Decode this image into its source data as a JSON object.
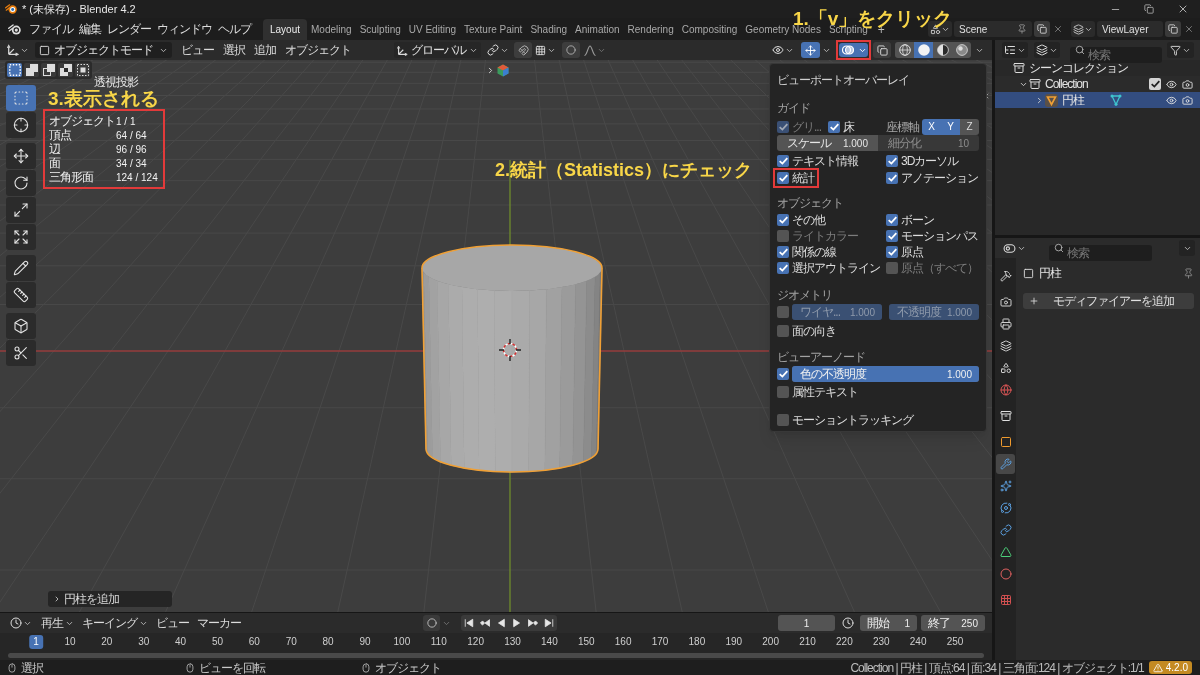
{
  "title_bar": {
    "title": "* (未保存) - Blender 4.2"
  },
  "top_bar": {
    "menus": [
      "ファイル",
      "編集",
      "レンダー",
      "ウィンドウ",
      "ヘルプ"
    ],
    "workspaces": [
      {
        "label": "Layout",
        "selected": true
      },
      {
        "label": "Modeling",
        "selected": false
      },
      {
        "label": "Sculpting",
        "selected": false
      },
      {
        "label": "UV Editing",
        "selected": false
      },
      {
        "label": "Texture Paint",
        "selected": false
      },
      {
        "label": "Shading",
        "selected": false
      },
      {
        "label": "Animation",
        "selected": false
      },
      {
        "label": "Rendering",
        "selected": false
      },
      {
        "label": "Compositing",
        "selected": false
      },
      {
        "label": "Geometry Nodes",
        "selected": false
      },
      {
        "label": "Scripting",
        "selected": false
      }
    ],
    "add_workspace": "+",
    "scene": "Scene",
    "view_layer": "ViewLayer"
  },
  "viewport_header": {
    "mode": "オブジェクトモード",
    "menus": [
      "ビュー",
      "選択",
      "追加",
      "オブジェクト"
    ],
    "orientation": "グローバル",
    "gizmos_on": true,
    "overlays_on": true,
    "overlays_highlighted": true,
    "shading": [
      {
        "kind": "wireframe",
        "selected": false
      },
      {
        "kind": "solid",
        "selected": true
      },
      {
        "kind": "material",
        "selected": false
      },
      {
        "kind": "rendered",
        "selected": false
      }
    ]
  },
  "viewport": {
    "select_modes": [
      {
        "kind": "new",
        "selected": true
      },
      {
        "kind": "extend",
        "selected": false
      },
      {
        "kind": "subtract",
        "selected": false
      },
      {
        "kind": "invert",
        "selected": false
      },
      {
        "kind": "intersect",
        "selected": false
      }
    ],
    "tool_settings_expanded": false,
    "tools": [
      {
        "kind": "select_box",
        "selected": true
      },
      {
        "kind": "cursor",
        "selected": false
      },
      {
        "kind": "move",
        "selected": false
      },
      {
        "kind": "rotate",
        "selected": false
      },
      {
        "kind": "scale",
        "selected": false
      },
      {
        "kind": "transform",
        "selected": false
      },
      {
        "kind": "annotate",
        "selected": false
      },
      {
        "kind": "measure",
        "selected": false
      },
      {
        "kind": "add_cube",
        "selected": false
      },
      {
        "kind": "cut",
        "selected": false
      }
    ],
    "view_name": "透視投影",
    "statistics": {
      "highlighted": true,
      "rows": [
        {
          "label": "オブジェクト",
          "value": "1 / 1"
        },
        {
          "label": "頂点",
          "value": "64 / 64"
        },
        {
          "label": "辺",
          "value": "96 / 96"
        },
        {
          "label": "面",
          "value": "34 / 34"
        },
        {
          "label": "三角形面",
          "value": "124 / 124"
        }
      ]
    },
    "last_operator": "円柱を追加"
  },
  "overlay_popup": {
    "title": "ビューポートオーバーレイ",
    "guides": {
      "title": "ガイド",
      "grid": {
        "label": "グリ...",
        "checked": true,
        "disabled": true
      },
      "floor": {
        "label": "床",
        "checked": true
      },
      "axes_label": "座標軸",
      "axes": [
        {
          "label": "X",
          "selected": true
        },
        {
          "label": "Y",
          "selected": true
        },
        {
          "label": "Z",
          "selected": false
        }
      ],
      "scale": {
        "label": "スケール",
        "value": "1.000"
      },
      "subdivisions": {
        "label": "細分化",
        "value": "10",
        "disabled": true
      },
      "options": [
        {
          "label": "テキスト情報",
          "checked": true,
          "highlighted": false
        },
        {
          "label": "3Dカーソル",
          "checked": true,
          "highlighted": false
        },
        {
          "label": "統計",
          "checked": true,
          "highlighted": true
        },
        {
          "label": "アノテーション",
          "checked": true,
          "highlighted": false
        }
      ]
    },
    "objects": {
      "title": "オブジェクト",
      "options": [
        {
          "label": "その他",
          "checked": true,
          "disabled": false
        },
        {
          "label": "ボーン",
          "checked": true,
          "disabled": false
        },
        {
          "label": "ライトカラー",
          "checked": false,
          "disabled": true
        },
        {
          "label": "モーションパス",
          "checked": true,
          "disabled": false
        },
        {
          "label": "関係の線",
          "checked": true,
          "disabled": false
        },
        {
          "label": "原点",
          "checked": true,
          "disabled": false
        },
        {
          "label": "選択アウトライン",
          "checked": true,
          "disabled": false
        },
        {
          "label": "原点（すべて）",
          "checked": false,
          "disabled": true
        }
      ]
    },
    "geometry": {
      "title": "ジオメトリ",
      "wireframe": {
        "checked": false,
        "label": "ワイヤ...",
        "value": "1.000",
        "level": 1,
        "disabled": true
      },
      "opacity": {
        "label": "不透明度",
        "value": "1.000",
        "level": 1,
        "disabled": true
      },
      "options": [
        {
          "label": "面の向き",
          "checked": false
        }
      ]
    },
    "viewer_node": {
      "title": "ビューアーノード",
      "color_opacity": {
        "checked": true,
        "label": "色の不透明度",
        "value": "1.000",
        "level": 1
      },
      "options": [
        {
          "label": "属性テキスト",
          "checked": false
        }
      ]
    },
    "motion_tracking": {
      "label": "モーショントラッキング",
      "checked": false
    }
  },
  "outliner": {
    "search_placeholder": "検索",
    "tree": [
      {
        "label": "シーンコレクション",
        "kind": "scene_collection",
        "children": [
          {
            "label": "Collection",
            "kind": "collection",
            "expanded": true,
            "checked": true,
            "selected": false,
            "children": [
              {
                "label": "円柱",
                "kind": "mesh_object",
                "expanded": false,
                "selected": true
              }
            ]
          }
        ]
      }
    ]
  },
  "properties": {
    "search_placeholder": "検索",
    "tabs": [
      {
        "kind": "tool",
        "selected": false
      },
      {
        "kind": "render",
        "selected": false
      },
      {
        "kind": "output",
        "selected": false
      },
      {
        "kind": "view_layer",
        "selected": false
      },
      {
        "kind": "scene",
        "selected": false
      },
      {
        "kind": "world",
        "selected": false
      },
      {
        "kind": "collection",
        "selected": false
      },
      {
        "kind": "object",
        "selected": false
      },
      {
        "kind": "modifiers",
        "selected": true
      },
      {
        "kind": "particles",
        "selected": false
      },
      {
        "kind": "physics",
        "selected": false
      },
      {
        "kind": "constraints",
        "selected": false
      },
      {
        "kind": "data",
        "selected": false
      },
      {
        "kind": "material",
        "selected": false
      },
      {
        "kind": "texture",
        "selected": false
      }
    ],
    "object_name": "円柱",
    "add_modifier": "モディファイアーを追加"
  },
  "timeline": {
    "menus": [
      {
        "label": "再生",
        "dropdown": true
      },
      {
        "label": "キーイング",
        "dropdown": true
      },
      {
        "label": "ビュー",
        "dropdown": false
      },
      {
        "label": "マーカー",
        "dropdown": false
      }
    ],
    "current_frame": "1",
    "start_label": "開始",
    "start": "1",
    "end_label": "終了",
    "end": "250",
    "ruler": [
      {
        "label": "1",
        "selected": true
      },
      {
        "label": "10",
        "selected": false
      },
      {
        "label": "20",
        "selected": false
      },
      {
        "label": "30",
        "selected": false
      },
      {
        "label": "40",
        "selected": false
      },
      {
        "label": "50",
        "selected": false
      },
      {
        "label": "60",
        "selected": false
      },
      {
        "label": "70",
        "selected": false
      },
      {
        "label": "80",
        "selected": false
      },
      {
        "label": "90",
        "selected": false
      },
      {
        "label": "100",
        "selected": false
      },
      {
        "label": "110",
        "selected": false
      },
      {
        "label": "120",
        "selected": false
      },
      {
        "label": "130",
        "selected": false
      },
      {
        "label": "140",
        "selected": false
      },
      {
        "label": "150",
        "selected": false
      },
      {
        "label": "160",
        "selected": false
      },
      {
        "label": "170",
        "selected": false
      },
      {
        "label": "180",
        "selected": false
      },
      {
        "label": "190",
        "selected": false
      },
      {
        "label": "200",
        "selected": false
      },
      {
        "label": "210",
        "selected": false
      },
      {
        "label": "220",
        "selected": false
      },
      {
        "label": "230",
        "selected": false
      },
      {
        "label": "240",
        "selected": false
      },
      {
        "label": "250",
        "selected": false
      }
    ]
  },
  "status_bar": {
    "hints": [
      "選択",
      "ビューを回転",
      "オブジェクト"
    ],
    "stats": "Collection | 円柱 | 頂点:64 | 面:34 | 三角面:124 | オブジェクト:1/1",
    "version": "4.2.0"
  },
  "annotations": [
    "1.「v」をクリック",
    "2.統計（Statistics）にチェック",
    "3.表示される"
  ]
}
